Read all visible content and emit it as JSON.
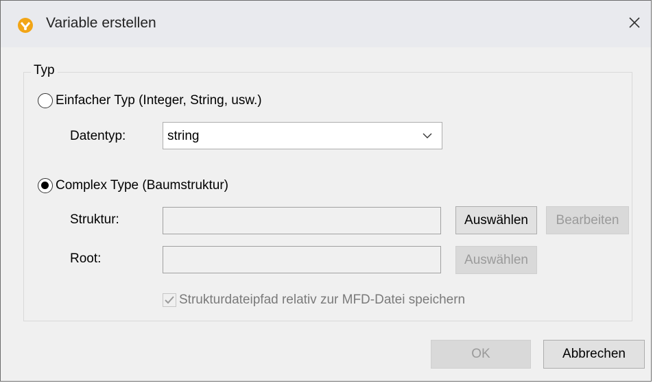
{
  "window": {
    "title": "Variable erstellen"
  },
  "group": {
    "label": "Typ"
  },
  "simple_type": {
    "radio_label": "Einfacher Typ (Integer, String, usw.)",
    "checked": false,
    "datatype_label": "Datentyp:",
    "datatype_value": "string"
  },
  "complex_type": {
    "radio_label": "Complex Type (Baumstruktur)",
    "checked": true,
    "structure_label": "Struktur:",
    "structure_value": "",
    "select_button": "Auswählen",
    "edit_button": "Bearbeiten",
    "root_label": "Root:",
    "root_value": "",
    "root_select_button": "Auswählen",
    "relative_path_label": "Strukturdateipfad relativ zur MFD-Datei speichern",
    "relative_path_checked": true
  },
  "footer": {
    "ok_label": "OK",
    "cancel_label": "Abbrechen"
  },
  "icons": {
    "app": "altova-mapforce-icon",
    "close": "close-icon"
  }
}
